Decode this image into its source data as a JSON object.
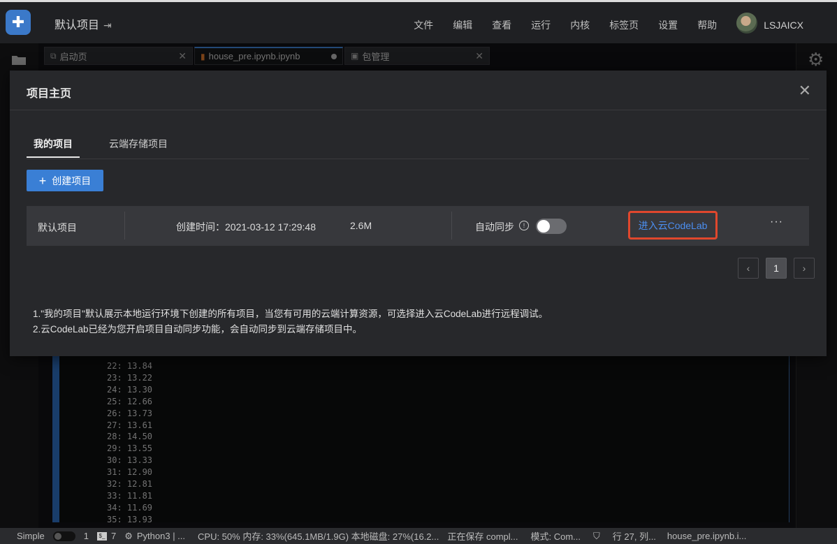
{
  "header": {
    "project_title": "默认项目",
    "project_title_icon": "exit-icon",
    "menu": [
      "文件",
      "编辑",
      "查看",
      "运行",
      "内核",
      "标签页",
      "设置",
      "帮助"
    ],
    "username": "LSJAICX"
  },
  "tabs": [
    {
      "label": "启动页",
      "icon": "launch-icon"
    },
    {
      "label": "house_pre.ipynb.ipynb",
      "icon": "notebook-icon"
    },
    {
      "label": "包管理",
      "icon": "package-icon"
    }
  ],
  "output_lines": [
    "22: 13.84",
    "23: 13.22",
    "24: 13.30",
    "25: 12.66",
    "26: 13.73",
    "27: 13.61",
    "28: 14.50",
    "29: 13.55",
    "30: 13.33",
    "31: 12.90",
    "32: 12.81",
    "33: 11.81",
    "34: 11.69",
    "35: 13.93"
  ],
  "modal": {
    "title": "项目主页",
    "tabs": [
      "我的项目",
      "云端存储项目"
    ],
    "create_button": "创建项目",
    "project": {
      "name": "默认项目",
      "created": "创建时间：2021-03-12 17:29:48",
      "size": "2.6M",
      "sync_label": "自动同步",
      "codelab_link": "进入云CodeLab",
      "more": "···"
    },
    "pagination": {
      "prev": "‹",
      "current": "1",
      "next": "›"
    },
    "notes": [
      "1.\"我的项目\"默认展示本地运行环境下创建的所有项目，当您有可用的云端计算资源，可选择进入云CodeLab进行远程调试。",
      "2.云CodeLab已经为您开启项目自动同步功能，会自动同步到云端存储项目中。"
    ]
  },
  "statusbar": {
    "mode": "Simple",
    "count1": "1",
    "count2": "7",
    "kernel": "Python3 | ...",
    "resources": "CPU:  50% 内存: 33%(645.1MB/1.9G) 本地磁盘: 27%(16.2...",
    "saving": "正在保存 compl...",
    "edit_mode": "模式: Com...",
    "position": "行 27, 列...",
    "file": "house_pre.ipynb.i..."
  },
  "colors": {
    "accent": "#3a7fd5",
    "highlight_border": "#e0472d",
    "link": "#4b8ef0"
  }
}
